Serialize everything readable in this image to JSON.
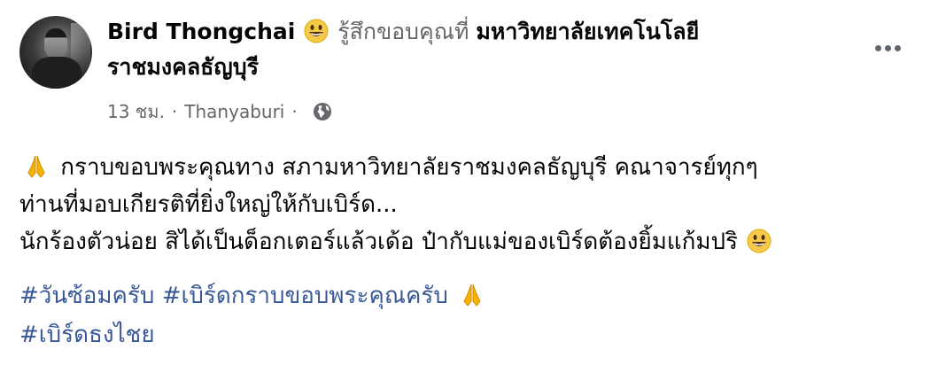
{
  "post": {
    "author_name": "Bird Thongchai",
    "feeling_text": "รู้สึกขอบคุณที่",
    "place_line1": "มหาวิทยาลัยเทคโนโลยี",
    "place_line2": "ราชมงคลธัญบุรี",
    "timestamp": "13 ชม.",
    "location": "Thanyaburi",
    "privacy_icon": "globe-icon",
    "menu_icon": "more-horizontal-icon",
    "content_line1": "กราบขอบพระคุณทาง สภามหาวิทยาลัยราชมงคลธัญบุรี คณาจารย์ทุกๆ",
    "content_line2": "ท่านที่มอบเกียรติที่ยิ่งใหญ่ให้กับเบิร์ด...",
    "content_line3": "นักร้องตัวน่อย สิได้เป็นด็อกเตอร์แล้วเด้อ ป๋ากับแม่ของเบิร์ดต้องยิ้มแก้มปริ",
    "hashtags": [
      "#วันซ้อมครับ",
      "#เบิร์ดกราบขอบพระคุณครับ",
      "#เบิร์ดธงไชย"
    ]
  },
  "colors": {
    "text_primary": "#050505",
    "text_secondary": "#65676b",
    "link": "#385898"
  }
}
